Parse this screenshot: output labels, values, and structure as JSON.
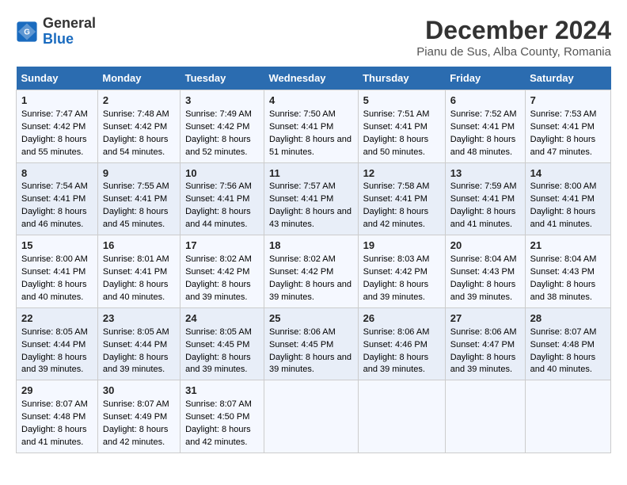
{
  "logo": {
    "general": "General",
    "blue": "Blue"
  },
  "title": "December 2024",
  "subtitle": "Pianu de Sus, Alba County, Romania",
  "days_of_week": [
    "Sunday",
    "Monday",
    "Tuesday",
    "Wednesday",
    "Thursday",
    "Friday",
    "Saturday"
  ],
  "weeks": [
    [
      {
        "day": "1",
        "sunrise": "Sunrise: 7:47 AM",
        "sunset": "Sunset: 4:42 PM",
        "daylight": "Daylight: 8 hours and 55 minutes."
      },
      {
        "day": "2",
        "sunrise": "Sunrise: 7:48 AM",
        "sunset": "Sunset: 4:42 PM",
        "daylight": "Daylight: 8 hours and 54 minutes."
      },
      {
        "day": "3",
        "sunrise": "Sunrise: 7:49 AM",
        "sunset": "Sunset: 4:42 PM",
        "daylight": "Daylight: 8 hours and 52 minutes."
      },
      {
        "day": "4",
        "sunrise": "Sunrise: 7:50 AM",
        "sunset": "Sunset: 4:41 PM",
        "daylight": "Daylight: 8 hours and 51 minutes."
      },
      {
        "day": "5",
        "sunrise": "Sunrise: 7:51 AM",
        "sunset": "Sunset: 4:41 PM",
        "daylight": "Daylight: 8 hours and 50 minutes."
      },
      {
        "day": "6",
        "sunrise": "Sunrise: 7:52 AM",
        "sunset": "Sunset: 4:41 PM",
        "daylight": "Daylight: 8 hours and 48 minutes."
      },
      {
        "day": "7",
        "sunrise": "Sunrise: 7:53 AM",
        "sunset": "Sunset: 4:41 PM",
        "daylight": "Daylight: 8 hours and 47 minutes."
      }
    ],
    [
      {
        "day": "8",
        "sunrise": "Sunrise: 7:54 AM",
        "sunset": "Sunset: 4:41 PM",
        "daylight": "Daylight: 8 hours and 46 minutes."
      },
      {
        "day": "9",
        "sunrise": "Sunrise: 7:55 AM",
        "sunset": "Sunset: 4:41 PM",
        "daylight": "Daylight: 8 hours and 45 minutes."
      },
      {
        "day": "10",
        "sunrise": "Sunrise: 7:56 AM",
        "sunset": "Sunset: 4:41 PM",
        "daylight": "Daylight: 8 hours and 44 minutes."
      },
      {
        "day": "11",
        "sunrise": "Sunrise: 7:57 AM",
        "sunset": "Sunset: 4:41 PM",
        "daylight": "Daylight: 8 hours and 43 minutes."
      },
      {
        "day": "12",
        "sunrise": "Sunrise: 7:58 AM",
        "sunset": "Sunset: 4:41 PM",
        "daylight": "Daylight: 8 hours and 42 minutes."
      },
      {
        "day": "13",
        "sunrise": "Sunrise: 7:59 AM",
        "sunset": "Sunset: 4:41 PM",
        "daylight": "Daylight: 8 hours and 41 minutes."
      },
      {
        "day": "14",
        "sunrise": "Sunrise: 8:00 AM",
        "sunset": "Sunset: 4:41 PM",
        "daylight": "Daylight: 8 hours and 41 minutes."
      }
    ],
    [
      {
        "day": "15",
        "sunrise": "Sunrise: 8:00 AM",
        "sunset": "Sunset: 4:41 PM",
        "daylight": "Daylight: 8 hours and 40 minutes."
      },
      {
        "day": "16",
        "sunrise": "Sunrise: 8:01 AM",
        "sunset": "Sunset: 4:41 PM",
        "daylight": "Daylight: 8 hours and 40 minutes."
      },
      {
        "day": "17",
        "sunrise": "Sunrise: 8:02 AM",
        "sunset": "Sunset: 4:42 PM",
        "daylight": "Daylight: 8 hours and 39 minutes."
      },
      {
        "day": "18",
        "sunrise": "Sunrise: 8:02 AM",
        "sunset": "Sunset: 4:42 PM",
        "daylight": "Daylight: 8 hours and 39 minutes."
      },
      {
        "day": "19",
        "sunrise": "Sunrise: 8:03 AM",
        "sunset": "Sunset: 4:42 PM",
        "daylight": "Daylight: 8 hours and 39 minutes."
      },
      {
        "day": "20",
        "sunrise": "Sunrise: 8:04 AM",
        "sunset": "Sunset: 4:43 PM",
        "daylight": "Daylight: 8 hours and 39 minutes."
      },
      {
        "day": "21",
        "sunrise": "Sunrise: 8:04 AM",
        "sunset": "Sunset: 4:43 PM",
        "daylight": "Daylight: 8 hours and 38 minutes."
      }
    ],
    [
      {
        "day": "22",
        "sunrise": "Sunrise: 8:05 AM",
        "sunset": "Sunset: 4:44 PM",
        "daylight": "Daylight: 8 hours and 39 minutes."
      },
      {
        "day": "23",
        "sunrise": "Sunrise: 8:05 AM",
        "sunset": "Sunset: 4:44 PM",
        "daylight": "Daylight: 8 hours and 39 minutes."
      },
      {
        "day": "24",
        "sunrise": "Sunrise: 8:05 AM",
        "sunset": "Sunset: 4:45 PM",
        "daylight": "Daylight: 8 hours and 39 minutes."
      },
      {
        "day": "25",
        "sunrise": "Sunrise: 8:06 AM",
        "sunset": "Sunset: 4:45 PM",
        "daylight": "Daylight: 8 hours and 39 minutes."
      },
      {
        "day": "26",
        "sunrise": "Sunrise: 8:06 AM",
        "sunset": "Sunset: 4:46 PM",
        "daylight": "Daylight: 8 hours and 39 minutes."
      },
      {
        "day": "27",
        "sunrise": "Sunrise: 8:06 AM",
        "sunset": "Sunset: 4:47 PM",
        "daylight": "Daylight: 8 hours and 39 minutes."
      },
      {
        "day": "28",
        "sunrise": "Sunrise: 8:07 AM",
        "sunset": "Sunset: 4:48 PM",
        "daylight": "Daylight: 8 hours and 40 minutes."
      }
    ],
    [
      {
        "day": "29",
        "sunrise": "Sunrise: 8:07 AM",
        "sunset": "Sunset: 4:48 PM",
        "daylight": "Daylight: 8 hours and 41 minutes."
      },
      {
        "day": "30",
        "sunrise": "Sunrise: 8:07 AM",
        "sunset": "Sunset: 4:49 PM",
        "daylight": "Daylight: 8 hours and 42 minutes."
      },
      {
        "day": "31",
        "sunrise": "Sunrise: 8:07 AM",
        "sunset": "Sunset: 4:50 PM",
        "daylight": "Daylight: 8 hours and 42 minutes."
      },
      null,
      null,
      null,
      null
    ]
  ]
}
